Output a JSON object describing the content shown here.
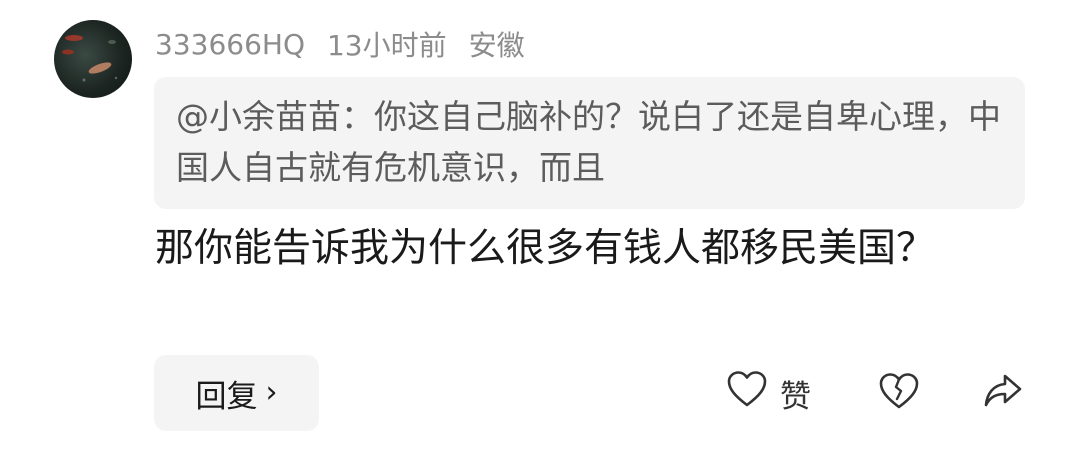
{
  "comment": {
    "username": "333666HQ",
    "time": "13小时前",
    "location": "安徽",
    "quoted": {
      "text": "@小余苗苗：你这自己脑补的？说白了还是自卑心理，中国人自古就有危机意识，而且"
    },
    "body": "那你能告诉我为什么很多有钱人都移民美国？"
  },
  "actions": {
    "reply_label": "回复",
    "reply_chevron": "›",
    "like_label": "赞",
    "like_icon": "heart-outline-icon",
    "dislike_icon": "broken-heart-icon",
    "share_icon": "share-arrow-icon"
  }
}
